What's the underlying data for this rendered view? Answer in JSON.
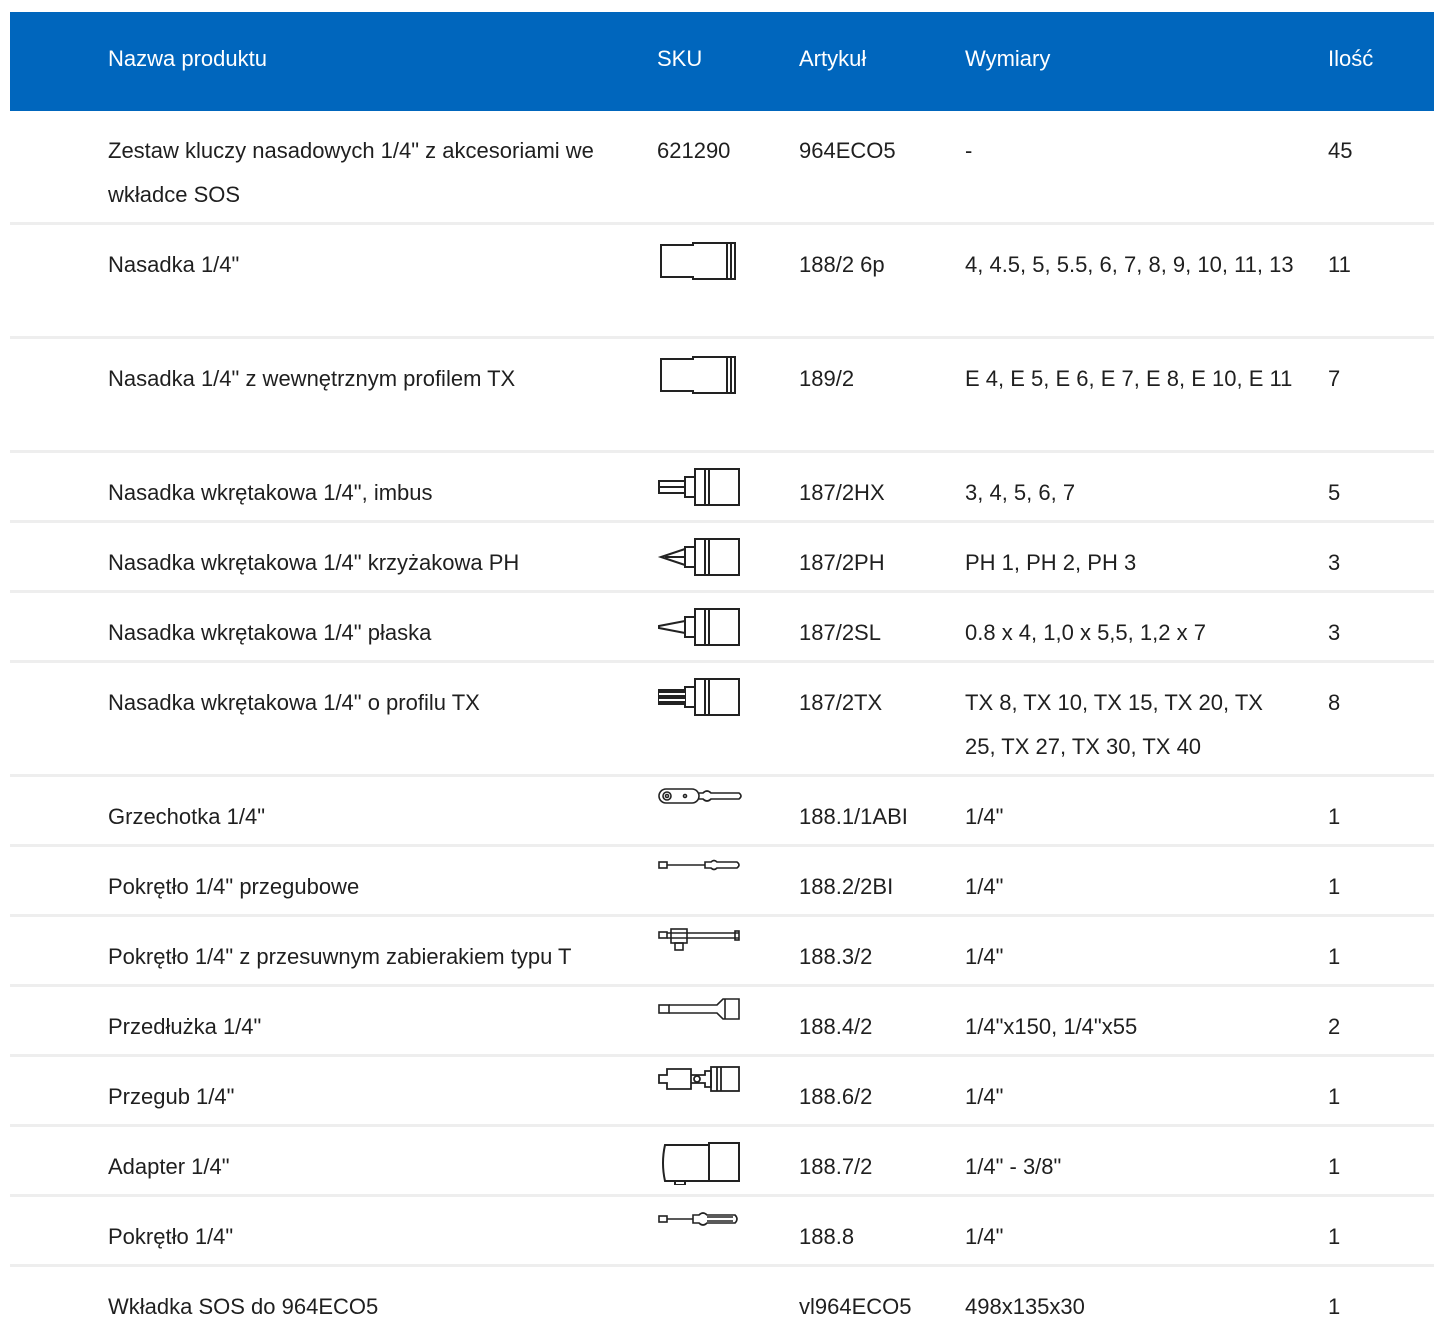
{
  "table": {
    "headers": {
      "name": "Nazwa produktu",
      "sku": "SKU",
      "article": "Artykuł",
      "dimensions": "Wymiary",
      "qty": "Ilość"
    },
    "rows": [
      {
        "name": "Zestaw kluczy nasadowych 1/4\" z akcesoriami we wkładce SOS",
        "sku": "621290",
        "icon": "",
        "article": "964ECO5",
        "dimensions": "-",
        "qty": "45"
      },
      {
        "name": "Nasadka 1/4\"",
        "sku": "",
        "icon": "socket-icon",
        "article": "188/2 6p",
        "dimensions": "4, 4.5, 5, 5.5, 6, 7, 8, 9, 10, 11, 13",
        "qty": "11"
      },
      {
        "name": "Nasadka 1/4\" z wewnętrznym profilem TX",
        "sku": "",
        "icon": "socket-tx-icon",
        "article": "189/2",
        "dimensions": "E 4, E 5, E 6, E 7, E 8, E 10, E 11",
        "qty": "7"
      },
      {
        "name": "Nasadka wkrętakowa 1/4\", imbus",
        "sku": "",
        "icon": "hex-bit-socket-icon",
        "article": "187/2HX",
        "dimensions": "3, 4, 5, 6, 7",
        "qty": "5"
      },
      {
        "name": "Nasadka wkrętakowa 1/4\" krzyżakowa PH",
        "sku": "",
        "icon": "phillips-bit-socket-icon",
        "article": "187/2PH",
        "dimensions": "PH 1, PH 2, PH 3",
        "qty": "3"
      },
      {
        "name": "Nasadka wkrętakowa 1/4\" płaska",
        "sku": "",
        "icon": "slotted-bit-socket-icon",
        "article": "187/2SL",
        "dimensions": "0.8 x 4, 1,0 x 5,5, 1,2 x 7",
        "qty": "3"
      },
      {
        "name": "Nasadka wkrętakowa 1/4\" o profilu TX",
        "sku": "",
        "icon": "torx-bit-socket-icon",
        "article": "187/2TX",
        "dimensions": "TX 8, TX 10, TX 15, TX 20, TX 25, TX 27, TX 30, TX 40",
        "qty": "8"
      },
      {
        "name": "Grzechotka 1/4\"",
        "sku": "",
        "icon": "ratchet-icon",
        "article": "188.1/1ABI",
        "dimensions": "1/4\"",
        "qty": "1"
      },
      {
        "name": "Pokrętło 1/4\" przegubowe",
        "sku": "",
        "icon": "flex-handle-icon",
        "article": "188.2/2BI",
        "dimensions": "1/4\"",
        "qty": "1"
      },
      {
        "name": "Pokrętło 1/4\" z przesuwnym zabierakiem typu T",
        "sku": "",
        "icon": "t-handle-icon",
        "article": "188.3/2",
        "dimensions": "1/4\"",
        "qty": "1"
      },
      {
        "name": "Przedłużka 1/4\"",
        "sku": "",
        "icon": "extension-bar-icon",
        "article": "188.4/2",
        "dimensions": "1/4\"x150, 1/4\"x55",
        "qty": "2"
      },
      {
        "name": "Przegub 1/4\"",
        "sku": "",
        "icon": "universal-joint-icon",
        "article": "188.6/2",
        "dimensions": "1/4\"",
        "qty": "1"
      },
      {
        "name": "Adapter 1/4\"",
        "sku": "",
        "icon": "adapter-icon",
        "article": "188.7/2",
        "dimensions": "1/4\" - 3/8\"",
        "qty": "1"
      },
      {
        "name": "Pokrętło 1/4\"",
        "sku": "",
        "icon": "screwdriver-handle-icon",
        "article": "188.8",
        "dimensions": "1/4\"",
        "qty": "1"
      },
      {
        "name": "Wkładka SOS do 964ECO5",
        "sku": "",
        "icon": "",
        "article": "vl964ECO5",
        "dimensions": "498x135x30",
        "qty": "1"
      }
    ]
  }
}
